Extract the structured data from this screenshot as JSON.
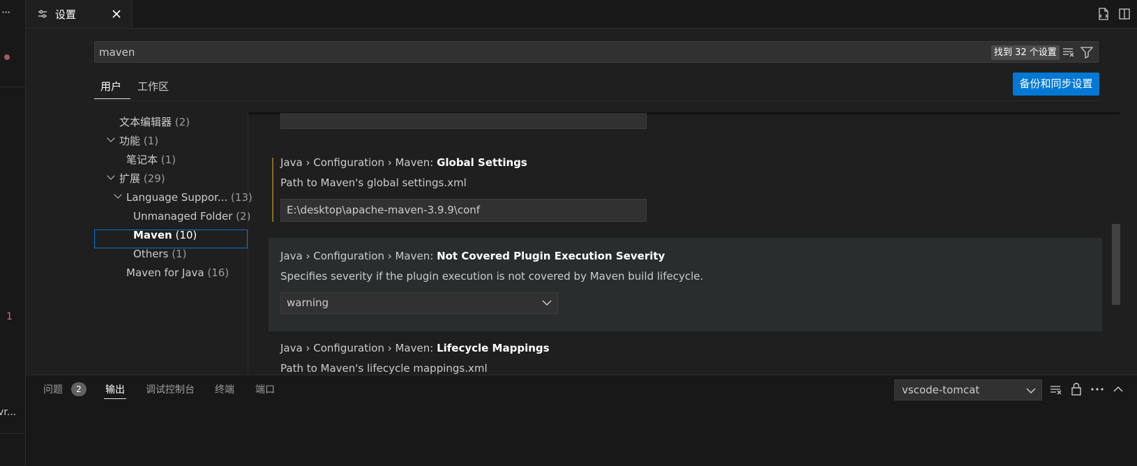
{
  "left_strip": {
    "dots": "···",
    "badge_count": "1",
    "truncated_label": "vr..."
  },
  "tab": {
    "label": "设置"
  },
  "search": {
    "value": "maven",
    "result_count": "找到 32 个设置"
  },
  "scope_tabs": {
    "user": "用户",
    "workspace": "工作区"
  },
  "sync_button": "备份和同步设置",
  "toc": [
    {
      "label": "文本编辑器",
      "count": "(2)"
    },
    {
      "label": "功能",
      "count": "(1)"
    },
    {
      "label": "笔记本",
      "count": "(1)"
    },
    {
      "label": "扩展",
      "count": "(29)"
    },
    {
      "label": "Language Suppor...",
      "count": "(13)"
    },
    {
      "label": "Unmanaged Folder",
      "count": "(2)"
    },
    {
      "label": "Maven",
      "count": "(10)"
    },
    {
      "label": "Others",
      "count": "(1)"
    },
    {
      "label": "Maven for Java",
      "count": "(16)"
    }
  ],
  "settings": {
    "global": {
      "prefix": "Java › Configuration › Maven: ",
      "name": "Global Settings",
      "description": "Path to Maven's global settings.xml",
      "value": "E:\\desktop\\apache-maven-3.9.9\\conf"
    },
    "not_covered": {
      "prefix": "Java › Configuration › Maven: ",
      "name": "Not Covered Plugin Execution Severity",
      "description": "Specifies severity if the plugin execution is not covered by Maven build lifecycle.",
      "value": "warning"
    },
    "lifecycle": {
      "prefix": "Java › Configuration › Maven: ",
      "name": "Lifecycle Mappings",
      "description": "Path to Maven's lifecycle mappings.xml"
    }
  },
  "panel": {
    "tabs": [
      "问题",
      "输出",
      "调试控制台",
      "终端",
      "端口"
    ],
    "problems_badge": "2",
    "output_channel": "vscode-tomcat"
  },
  "colors": {
    "accent": "#0078d4",
    "modified": "#8a6d1b",
    "background": "#1f1f1f"
  }
}
